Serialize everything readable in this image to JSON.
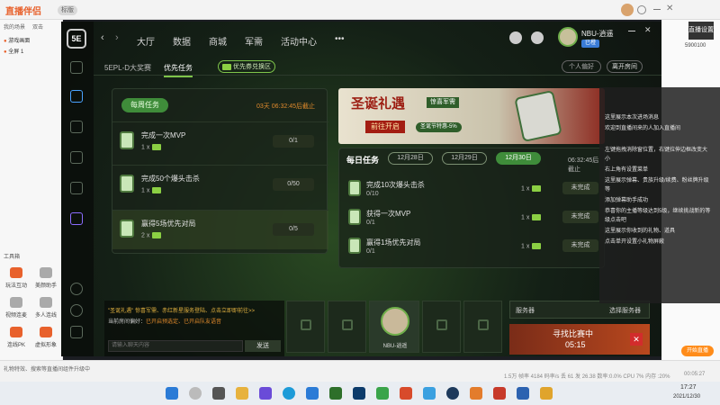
{
  "stream_app": {
    "logo": "直播伴侣",
    "version_badge": "标版",
    "scene_tabs": [
      "我的场景",
      "双击"
    ],
    "sources": [
      "游戏画面",
      "全屏 1"
    ],
    "tools": [
      "玩法互动",
      "美颜助手",
      "视频连麦",
      "多人连线",
      "连线PK",
      "虚拟形象"
    ],
    "tools_header": "工具箱",
    "status_bar": "1.5万 帧率 4184 码率/s 丢 61 发 26.38 数率:0.0% CPU 7% 内存 :20%",
    "time": "00:05:27",
    "start_button": "开始直播",
    "bottom_notice": "礼物特效、搜索等直播间组件升级中",
    "right_panel": {
      "title": "直播设置",
      "count": "5900100"
    }
  },
  "game": {
    "title": "5E",
    "nav": [
      "大厅",
      "数据",
      "商城",
      "军需",
      "活动中心",
      "•••"
    ],
    "user": {
      "name": "NBU-逍遥",
      "badge": "已橙"
    },
    "subnav": {
      "tab1": "5EPL-D大奖赛",
      "tab2": "优先任务",
      "exchange": "优先券兑换区"
    },
    "buttons": {
      "settings": "个人偏好",
      "leave": "离开房间"
    },
    "weekly": {
      "title": "每周任务",
      "deadline": "03天 06:32:45后截止",
      "tasks": [
        {
          "name": "完成一次MVP",
          "reward": "1 x",
          "progress": "0/1"
        },
        {
          "name": "完成50个爆头击杀",
          "reward": "1 x",
          "progress": "0/50"
        },
        {
          "name": "赢得5场优先对局",
          "reward": "2 x",
          "progress": "0/5"
        }
      ]
    },
    "banner": {
      "title": "圣诞礼遇",
      "subtitle": "惊喜军需",
      "cta": "前往开启",
      "tag": "圣诞节特惠-5%"
    },
    "daily": {
      "title": "每日任务",
      "dates": [
        "12月28日",
        "12月29日",
        "12月30日"
      ],
      "selected_date": "12月30日",
      "deadline": "06:32:45后截止",
      "tasks": [
        {
          "name": "完成10次爆头击杀",
          "progress": "0/10",
          "reward": "1 x",
          "status": "未完成"
        },
        {
          "name": "获得一次MVP",
          "progress": "0/1",
          "reward": "1 x",
          "status": "未完成"
        },
        {
          "name": "赢得1场优先对局",
          "progress": "0/1",
          "reward": "1 x",
          "status": "未完成"
        }
      ]
    },
    "chat": {
      "notice_prefix": "\"圣诞礼遇\"",
      "notice": "惊喜军需、赤红新星服务登陆、点击立即即前往>>",
      "room_prefs": "当前房间偏好：",
      "prefs_detail": "已开启预选定、已开启队友语音",
      "input_placeholder": "请输入聊天内容",
      "send": "发送"
    },
    "party_slot_name": "NBU-逍遥",
    "server": {
      "label": "服务器",
      "select": "选择服务器"
    },
    "matching": {
      "label": "寻找比赛中",
      "time": "05:15"
    }
  },
  "chat_overlay": {
    "lines": [
      "这里展示本次进场消息",
      "欢迎到直播间来的人加入直播间",
      "左键拖拽消除窗位置，右键拉伸边框改变大",
      "小",
      "右上角有设置菜单",
      "这里展示弹幕、贵族升级/续费、粉丝牌升级",
      "等",
      "添加弹幕助手成功",
      "恭喜你的主播等级达到5级，继续挑战新的等",
      "级点击吧",
      "这里展示你收到的礼物、道具",
      "点击单开设置小礼物屏蔽"
    ]
  },
  "taskbar": {
    "time": "17:27",
    "date": "2021/12/30"
  }
}
